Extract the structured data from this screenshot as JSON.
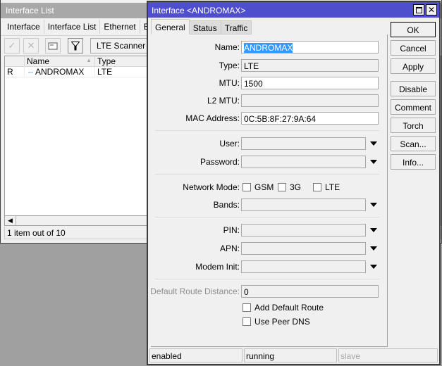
{
  "list_window": {
    "title": "Interface List",
    "tabs": [
      {
        "label": "Interface"
      },
      {
        "label": "Interface List"
      },
      {
        "label": "Ethernet"
      },
      {
        "label": "EoIP Tunnel"
      }
    ],
    "toolbar": {
      "enable_icon": "check-icon",
      "disable_icon": "cross-icon",
      "comment_icon": "comment-icon",
      "filter_icon": "filter-icon",
      "lte_scanner_label": "LTE Scanner"
    },
    "columns": [
      {
        "label": ""
      },
      {
        "label": "Name"
      },
      {
        "label": "Type"
      }
    ],
    "rows": [
      {
        "flag": "R",
        "icon": "lte-interface-icon",
        "name": "ANDROMAX",
        "type": "LTE"
      }
    ],
    "status": "1 item out of 10"
  },
  "dialog": {
    "title": "Interface <ANDROMAX>",
    "tabs": [
      {
        "label": "General",
        "active": true
      },
      {
        "label": "Status",
        "active": false
      },
      {
        "label": "Traffic",
        "active": false
      }
    ],
    "fields": {
      "name": {
        "label": "Name:",
        "value": "ANDROMAX"
      },
      "type": {
        "label": "Type:",
        "value": "LTE"
      },
      "mtu": {
        "label": "MTU:",
        "value": "1500"
      },
      "l2mtu": {
        "label": "L2 MTU:",
        "value": ""
      },
      "mac": {
        "label": "MAC Address:",
        "value": "0C:5B:8F:27:9A:64"
      },
      "user": {
        "label": "User:",
        "value": ""
      },
      "password": {
        "label": "Password:",
        "value": ""
      },
      "network_mode": {
        "label": "Network Mode:",
        "options": [
          {
            "label": "GSM",
            "checked": false
          },
          {
            "label": "3G",
            "checked": false
          },
          {
            "label": "LTE",
            "checked": false
          }
        ]
      },
      "bands": {
        "label": "Bands:",
        "value": ""
      },
      "pin": {
        "label": "PIN:",
        "value": ""
      },
      "apn": {
        "label": "APN:",
        "value": ""
      },
      "modem_init": {
        "label": "Modem Init:",
        "value": ""
      },
      "default_route_distance": {
        "label": "Default Route Distance:",
        "value": "0"
      },
      "add_default_route": {
        "label": "Add Default Route",
        "checked": false
      },
      "use_peer_dns": {
        "label": "Use Peer DNS",
        "checked": false
      }
    },
    "buttons": {
      "ok": "OK",
      "cancel": "Cancel",
      "apply": "Apply",
      "disable": "Disable",
      "comment": "Comment",
      "torch": "Torch",
      "scan": "Scan...",
      "info": "Info..."
    },
    "status_bar": [
      "enabled",
      "running",
      "slave"
    ]
  }
}
